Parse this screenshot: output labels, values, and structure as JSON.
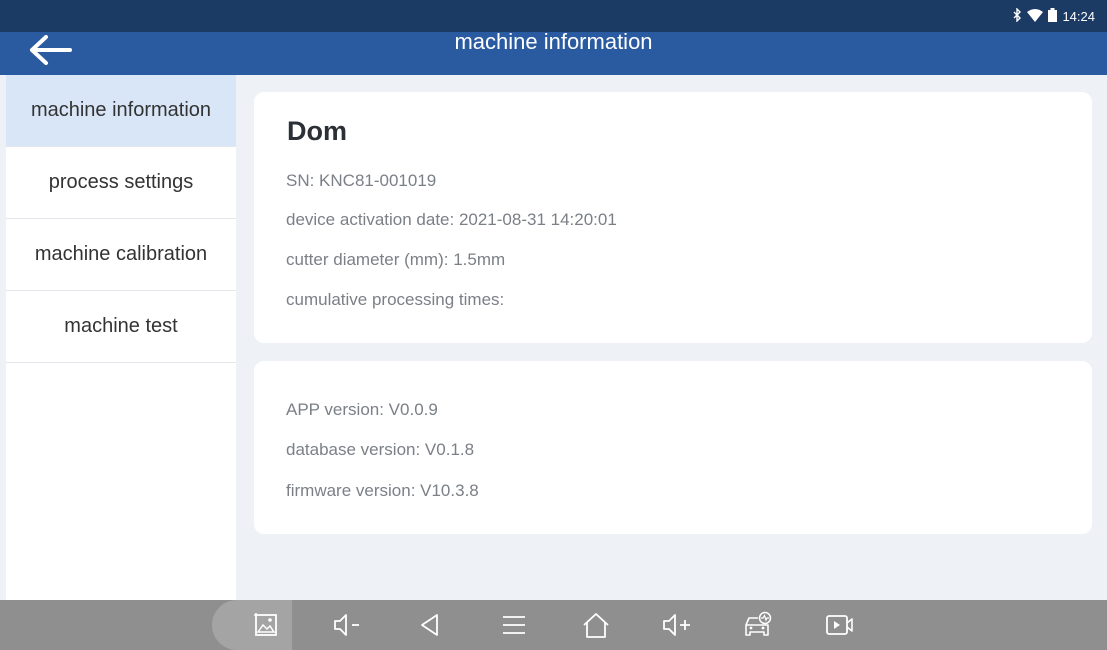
{
  "status_bar": {
    "time": "14:24",
    "icons": [
      "bluetooth-icon",
      "wifi-icon",
      "battery-icon"
    ]
  },
  "header": {
    "title": "machine information",
    "back_icon": "arrow-left-icon"
  },
  "sidebar": {
    "items": [
      {
        "label": "machine information",
        "active": true
      },
      {
        "label": "process settings",
        "active": false
      },
      {
        "label": "machine calibration",
        "active": false
      },
      {
        "label": "machine test",
        "active": false
      }
    ]
  },
  "machine_card": {
    "name": "Dom",
    "sn": "SN: KNC81-001019",
    "activation_date": "device activation date: 2021-08-31 14:20:01",
    "cutter_diameter": "cutter diameter (mm): 1.5mm",
    "processing_times": "cumulative processing times:"
  },
  "version_card": {
    "app_version": "APP version: V0.0.9",
    "database_version": "database version: V0.1.8",
    "firmware_version": "firmware version: V10.3.8"
  },
  "nav_bar": {
    "buttons": [
      "screenshot-icon",
      "volume-down-icon",
      "back-triangle-icon",
      "menu-icon",
      "home-icon",
      "volume-up-icon",
      "car-diagnostic-icon",
      "screen-record-icon"
    ]
  },
  "colors": {
    "header_bg": "#2a5aa0",
    "status_bg": "#1b3a64",
    "sidebar_active": "#d9e6f7",
    "nav_bar_bg": "#8f8f8f",
    "page_bg": "#eef1f6"
  }
}
